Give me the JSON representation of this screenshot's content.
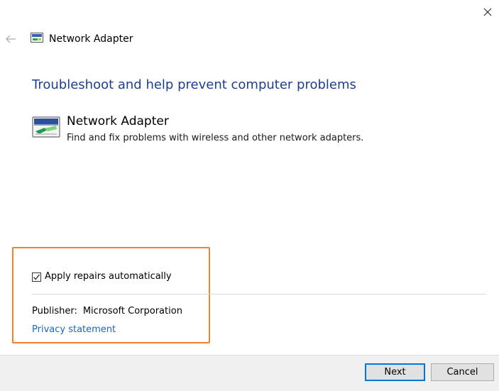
{
  "window": {
    "title": "Network Adapter",
    "close_icon": "close-icon",
    "back_icon": "back-arrow-icon"
  },
  "main": {
    "heading": "Troubleshoot and help prevent computer problems",
    "item": {
      "icon": "network-adapter-icon",
      "name": "Network Adapter",
      "description": "Find and fix problems with wireless and other network adapters."
    },
    "options": {
      "apply_repairs": {
        "label": "Apply repairs automatically",
        "checked": true
      },
      "publisher_label": "Publisher:",
      "publisher_value": "Microsoft Corporation",
      "privacy_link": "Privacy statement"
    }
  },
  "footer": {
    "next_label": "Next",
    "cancel_label": "Cancel"
  },
  "colors": {
    "heading": "#1e3f8e",
    "link": "#1a66c4",
    "highlight": "#f0822f",
    "focus": "#0078d7"
  }
}
